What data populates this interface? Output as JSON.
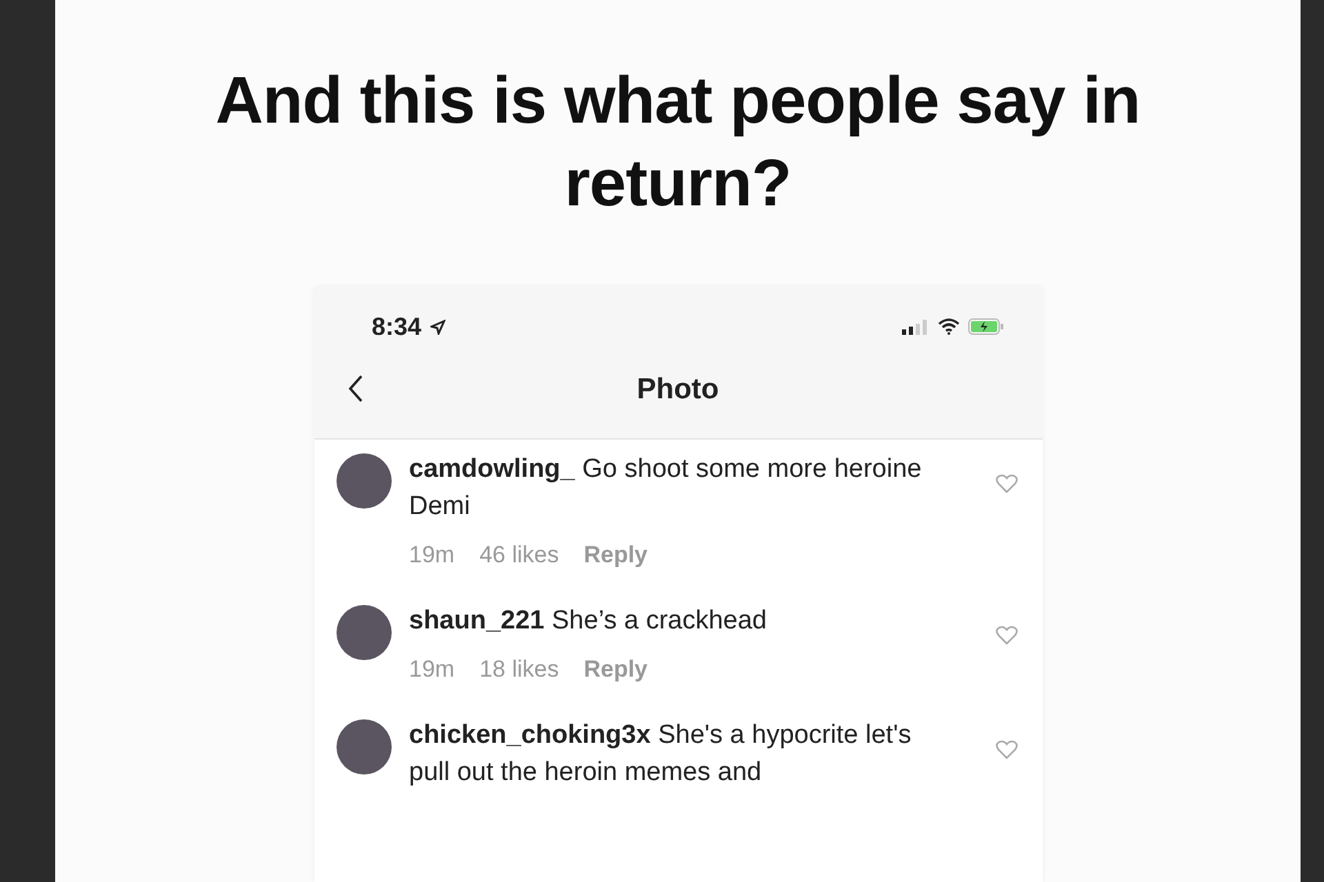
{
  "heading": "And this is what people say in return?",
  "status_bar": {
    "time": "8:34"
  },
  "header": {
    "title": "Photo"
  },
  "comments": [
    {
      "user": "camdowling_",
      "text": "Go shoot some more heroine Demi",
      "age": "19m",
      "likes": "46 likes",
      "reply": "Reply"
    },
    {
      "user": "shaun_221",
      "text": "She’s a crackhead",
      "age": "19m",
      "likes": "18 likes",
      "reply": "Reply"
    },
    {
      "user": "chicken_choking3x",
      "text": "She's a hypocrite let's pull out the heroin memes and"
    }
  ]
}
